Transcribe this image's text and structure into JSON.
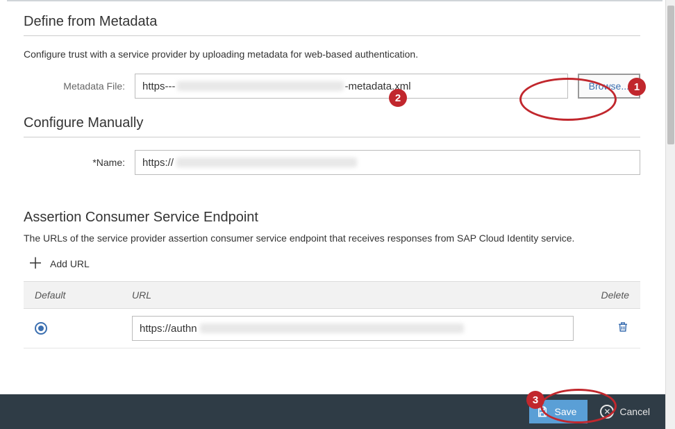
{
  "sections": {
    "metadata": {
      "title": "Define from Metadata",
      "description": "Configure trust with a service provider by uploading metadata for web-based authentication.",
      "file_label": "Metadata File:",
      "file_value_prefix": "https---",
      "file_value_suffix": "-metadata.xml",
      "browse_label": "Browse..."
    },
    "manual": {
      "title": "Configure Manually",
      "name_label": "*Name:",
      "name_value_prefix": "https://"
    },
    "ace": {
      "title": "Assertion Consumer Service Endpoint",
      "description": "The URLs of the service provider assertion consumer service endpoint that receives responses from SAP Cloud Identity service.",
      "add_url_label": "Add URL",
      "columns": {
        "default": "Default",
        "url": "URL",
        "delete": "Delete"
      },
      "rows": [
        {
          "default": true,
          "url_prefix": "https://authn"
        }
      ]
    }
  },
  "footer": {
    "save_label": "Save",
    "cancel_label": "Cancel"
  },
  "annotations": {
    "c1": "1",
    "c2": "2",
    "c3": "3"
  }
}
